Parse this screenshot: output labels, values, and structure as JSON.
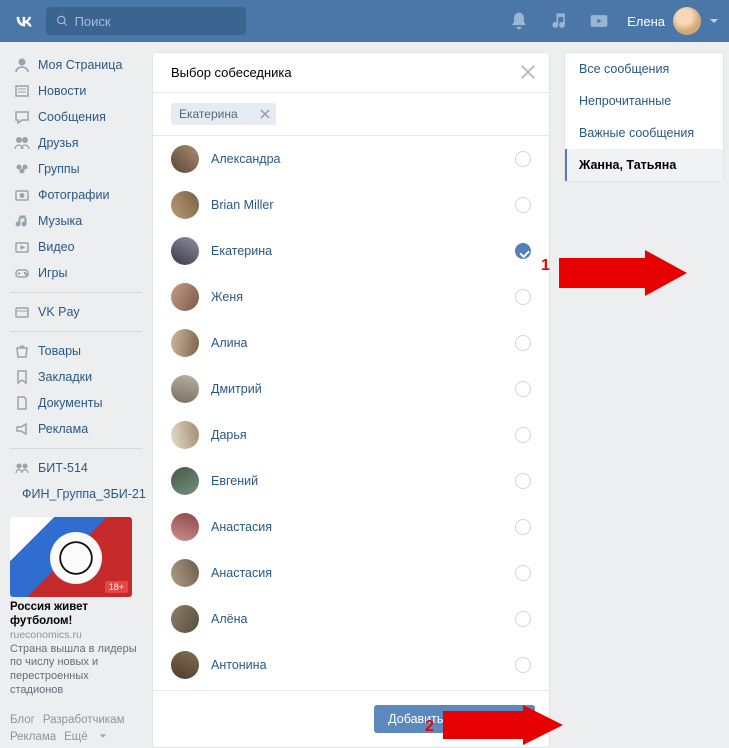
{
  "header": {
    "search_placeholder": "Поиск",
    "username": "Елена"
  },
  "sidebar": {
    "items": [
      {
        "label": "Моя Страница",
        "icon": "home-icon"
      },
      {
        "label": "Новости",
        "icon": "news-icon"
      },
      {
        "label": "Сообщения",
        "icon": "messages-icon"
      },
      {
        "label": "Друзья",
        "icon": "friends-icon"
      },
      {
        "label": "Группы",
        "icon": "groups-icon"
      },
      {
        "label": "Фотографии",
        "icon": "photos-icon"
      },
      {
        "label": "Музыка",
        "icon": "music-icon"
      },
      {
        "label": "Видео",
        "icon": "video-icon"
      },
      {
        "label": "Игры",
        "icon": "games-icon"
      }
    ],
    "items2": [
      {
        "label": "VK Pay",
        "icon": "pay-icon"
      }
    ],
    "items3": [
      {
        "label": "Товары",
        "icon": "market-icon"
      },
      {
        "label": "Закладки",
        "icon": "bookmark-icon"
      },
      {
        "label": "Документы",
        "icon": "docs-icon"
      },
      {
        "label": "Реклама",
        "icon": "ads-icon"
      }
    ],
    "items4": [
      {
        "label": "БИТ-514",
        "icon": "group-icon"
      },
      {
        "label": "ФИН_Группа_ЗБИ-21",
        "icon": "group-icon"
      }
    ]
  },
  "ad": {
    "badge": "18+",
    "title": "Россия живет футболом!",
    "site": "rueconomics.ru",
    "description": "Страна вышла в лидеры по числу новых и перестроенных стадионов"
  },
  "footer": {
    "links": [
      "Блог",
      "Разработчикам",
      "Реклама",
      "Ещё"
    ]
  },
  "dialog": {
    "title": "Выбор собеседника",
    "chip": "Екатерина",
    "button": "Добавить собеседника",
    "items": [
      {
        "name": "Александра",
        "selected": false,
        "ava": "a1"
      },
      {
        "name": "Brian Miller",
        "selected": false,
        "ava": "a2"
      },
      {
        "name": "Екатерина",
        "selected": true,
        "ava": "a3"
      },
      {
        "name": "Женя",
        "selected": false,
        "ava": "a4"
      },
      {
        "name": "Алина",
        "selected": false,
        "ava": "a5"
      },
      {
        "name": "Дмитрий",
        "selected": false,
        "ava": "a6"
      },
      {
        "name": "Дарья",
        "selected": false,
        "ava": "a7"
      },
      {
        "name": "Евгений",
        "selected": false,
        "ava": "a8"
      },
      {
        "name": "Анастасия",
        "selected": false,
        "ava": "a9"
      },
      {
        "name": "Анастасия",
        "selected": false,
        "ava": "a10"
      },
      {
        "name": "Алёна",
        "selected": false,
        "ava": "a11"
      },
      {
        "name": "Антонина",
        "selected": false,
        "ava": "a12"
      }
    ]
  },
  "filters": {
    "items": [
      {
        "label": "Все сообщения",
        "active": false
      },
      {
        "label": "Непрочитанные",
        "active": false
      },
      {
        "label": "Важные сообщения",
        "active": false
      },
      {
        "label": "Жанна, Татьяна",
        "active": true
      }
    ]
  },
  "annotations": {
    "marker1": "1",
    "marker2": "2"
  }
}
